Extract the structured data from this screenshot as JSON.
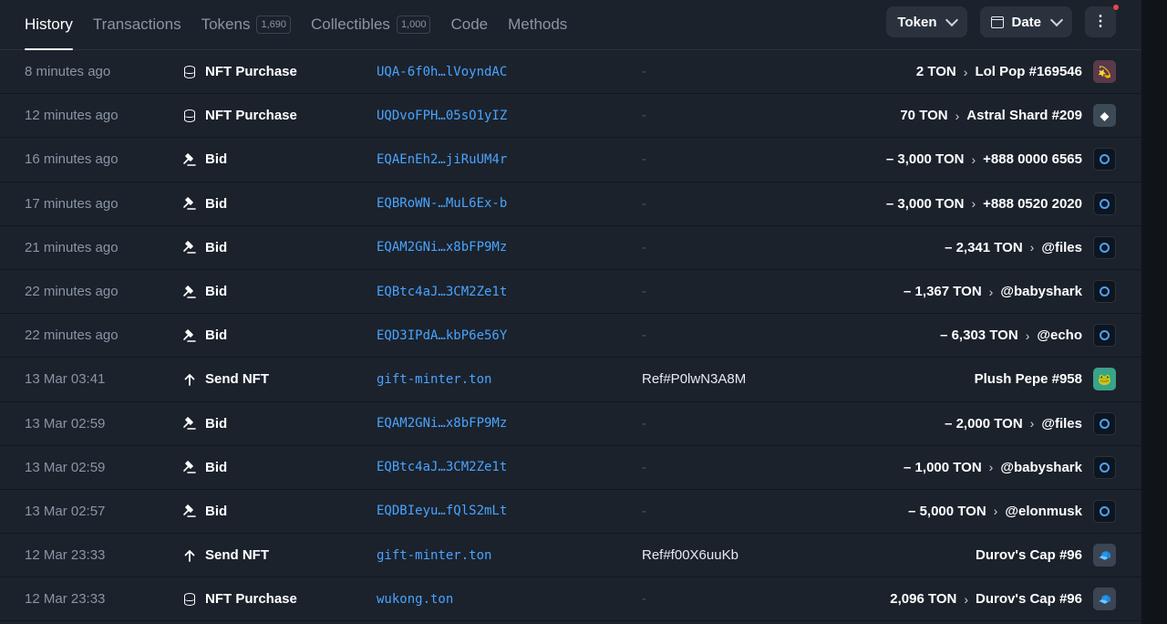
{
  "tabs": [
    {
      "label": "History",
      "active": true,
      "badge": ""
    },
    {
      "label": "Transactions",
      "active": false,
      "badge": ""
    },
    {
      "label": "Tokens",
      "active": false,
      "badge": "1,690"
    },
    {
      "label": "Collectibles",
      "active": false,
      "badge": "1,000"
    },
    {
      "label": "Code",
      "active": false,
      "badge": ""
    },
    {
      "label": "Methods",
      "active": false,
      "badge": ""
    }
  ],
  "controls": {
    "token_label": "Token",
    "date_label": "Date",
    "more_icon": "more-vertical-icon"
  },
  "colors": {
    "background": "#1b222c",
    "link": "#4aa3ff",
    "muted": "#8a95a5",
    "notification": "#e5484d"
  },
  "rows": [
    {
      "time": "8 minutes ago",
      "icon": "database-icon",
      "action": "NFT Purchase",
      "address": "UQA-6f0h…lVoyndAC",
      "comment": "-",
      "amount": "2 TON",
      "target": "Lol Pop #169546",
      "thumb": "nft-lol-pop-icon"
    },
    {
      "time": "12 minutes ago",
      "icon": "database-icon",
      "action": "NFT Purchase",
      "address": "UQDvoFPH…05sO1yIZ",
      "comment": "-",
      "amount": "70 TON",
      "target": "Astral Shard #209",
      "thumb": "nft-astral-shard-icon"
    },
    {
      "time": "16 minutes ago",
      "icon": "gavel-icon",
      "action": "Bid",
      "address": "EQAEnEh2…jiRuUM4r",
      "comment": "-",
      "amount": "– 3,000 TON",
      "target": "+888 0000 6565",
      "thumb": "anonymous-number-icon"
    },
    {
      "time": "17 minutes ago",
      "icon": "gavel-icon",
      "action": "Bid",
      "address": "EQBRoWN-…MuL6Ex-b",
      "comment": "-",
      "amount": "– 3,000 TON",
      "target": "+888 0520 2020",
      "thumb": "anonymous-number-icon"
    },
    {
      "time": "21 minutes ago",
      "icon": "gavel-icon",
      "action": "Bid",
      "address": "EQAM2GNi…x8bFP9Mz",
      "comment": "-",
      "amount": "– 2,341 TON",
      "target": "@files",
      "thumb": "username-icon"
    },
    {
      "time": "22 minutes ago",
      "icon": "gavel-icon",
      "action": "Bid",
      "address": "EQBtc4aJ…3CM2Ze1t",
      "comment": "-",
      "amount": "– 1,367 TON",
      "target": "@babyshark",
      "thumb": "username-icon"
    },
    {
      "time": "22 minutes ago",
      "icon": "gavel-icon",
      "action": "Bid",
      "address": "EQD3IPdA…kbP6e56Y",
      "comment": "-",
      "amount": "– 6,303 TON",
      "target": "@echo",
      "thumb": "username-icon"
    },
    {
      "time": "13 Mar 03:41",
      "icon": "arrow-up-icon",
      "action": "Send NFT",
      "address": "gift-minter.ton",
      "comment": "Ref#P0lwN3A8M",
      "amount": "",
      "target": "Plush Pepe #958",
      "thumb": "nft-plush-pepe-icon"
    },
    {
      "time": "13 Mar 02:59",
      "icon": "gavel-icon",
      "action": "Bid",
      "address": "EQAM2GNi…x8bFP9Mz",
      "comment": "-",
      "amount": "– 2,000 TON",
      "target": "@files",
      "thumb": "username-icon"
    },
    {
      "time": "13 Mar 02:59",
      "icon": "gavel-icon",
      "action": "Bid",
      "address": "EQBtc4aJ…3CM2Ze1t",
      "comment": "-",
      "amount": "– 1,000 TON",
      "target": "@babyshark",
      "thumb": "username-icon"
    },
    {
      "time": "13 Mar 02:57",
      "icon": "gavel-icon",
      "action": "Bid",
      "address": "EQDBIeyu…fQlS2mLt",
      "comment": "-",
      "amount": "– 5,000 TON",
      "target": "@elonmusk",
      "thumb": "username-icon"
    },
    {
      "time": "12 Mar 23:33",
      "icon": "arrow-up-icon",
      "action": "Send NFT",
      "address": "gift-minter.ton",
      "comment": "Ref#f00X6uuKb",
      "amount": "",
      "target": "Durov's Cap #96",
      "thumb": "nft-durovs-cap-icon"
    },
    {
      "time": "12 Mar 23:33",
      "icon": "database-icon",
      "action": "NFT Purchase",
      "address": "wukong.ton",
      "comment": "-",
      "amount": "2,096 TON",
      "target": "Durov's Cap #96",
      "thumb": "nft-durovs-cap-icon"
    }
  ]
}
